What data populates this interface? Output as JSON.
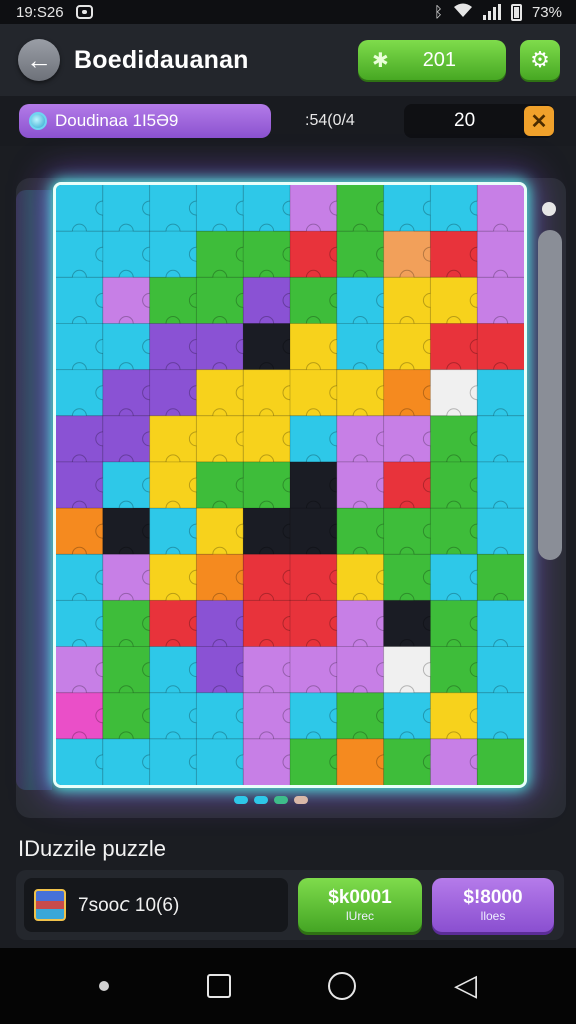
{
  "status_bar": {
    "time": "19:S26",
    "battery_text": "73%",
    "icons": [
      "notification-icon",
      "bluetooth-icon",
      "wifi-icon",
      "signal-icon",
      "battery-icon"
    ]
  },
  "header": {
    "back_icon": "back-arrow-icon",
    "title": "Boedidauanan",
    "coins_icon": "gear-coin-icon",
    "coins_value": "201",
    "settings_icon": "gear-icon"
  },
  "subbar": {
    "level_label": "Doudinaa 1I5Ə9",
    "code": ":54(0/4",
    "moves_value": "20",
    "close_icon": "close-icon"
  },
  "board": {
    "rows": 13,
    "cols": 10,
    "piece_colors": [
      [
        "#2ec8e8",
        "#2ec8e8",
        "#2ec8e8",
        "#2ec8e8",
        "#2ec8e8",
        "#c77fe6",
        "#3ebd3a",
        "#2ec8e8",
        "#2ec8e8",
        "#c77fe6"
      ],
      [
        "#2ec8e8",
        "#2ec8e8",
        "#2ec8e8",
        "#3ebd3a",
        "#3ebd3a",
        "#e8333b",
        "#3ebd3a",
        "#f2a05a",
        "#e8333b",
        "#c77fe6"
      ],
      [
        "#2ec8e8",
        "#c77fe6",
        "#3ebd3a",
        "#3ebd3a",
        "#8a52d4",
        "#3ebd3a",
        "#2ec8e8",
        "#f7d21c",
        "#f7d21c",
        "#c77fe6"
      ],
      [
        "#2ec8e8",
        "#2ec8e8",
        "#8a52d4",
        "#8a52d4",
        "#1a1c24",
        "#f7d21c",
        "#2ec8e8",
        "#f7d21c",
        "#e8333b",
        "#e8333b"
      ],
      [
        "#2ec8e8",
        "#8a52d4",
        "#8a52d4",
        "#f7d21c",
        "#f7d21c",
        "#f7d21c",
        "#f7d21c",
        "#f58a1f",
        "#f0f0f0",
        "#2ec8e8"
      ],
      [
        "#8a52d4",
        "#8a52d4",
        "#f7d21c",
        "#f7d21c",
        "#f7d21c",
        "#2ec8e8",
        "#c77fe6",
        "#c77fe6",
        "#3ebd3a",
        "#2ec8e8"
      ],
      [
        "#8a52d4",
        "#2ec8e8",
        "#f7d21c",
        "#3ebd3a",
        "#3ebd3a",
        "#1a1c24",
        "#c77fe6",
        "#e8333b",
        "#3ebd3a",
        "#2ec8e8"
      ],
      [
        "#f58a1f",
        "#1a1c24",
        "#2ec8e8",
        "#f7d21c",
        "#1a1c24",
        "#1a1c24",
        "#3ebd3a",
        "#3ebd3a",
        "#3ebd3a",
        "#2ec8e8"
      ],
      [
        "#2ec8e8",
        "#c77fe6",
        "#f7d21c",
        "#f58a1f",
        "#e8333b",
        "#e8333b",
        "#f7d21c",
        "#3ebd3a",
        "#2ec8e8",
        "#3ebd3a"
      ],
      [
        "#2ec8e8",
        "#3ebd3a",
        "#e8333b",
        "#8a52d4",
        "#e8333b",
        "#e8333b",
        "#c77fe6",
        "#1a1c24",
        "#3ebd3a",
        "#2ec8e8"
      ],
      [
        "#c77fe6",
        "#3ebd3a",
        "#2ec8e8",
        "#8a52d4",
        "#c77fe6",
        "#c77fe6",
        "#c77fe6",
        "#f0f0f0",
        "#3ebd3a",
        "#2ec8e8"
      ],
      [
        "#ea4fc8",
        "#3ebd3a",
        "#2ec8e8",
        "#2ec8e8",
        "#c77fe6",
        "#2ec8e8",
        "#3ebd3a",
        "#2ec8e8",
        "#f7d21c",
        "#2ec8e8"
      ],
      [
        "#2ec8e8",
        "#2ec8e8",
        "#2ec8e8",
        "#2ec8e8",
        "#c77fe6",
        "#3ebd3a",
        "#f58a1f",
        "#3ebd3a",
        "#c77fe6",
        "#3ebd3a"
      ]
    ]
  },
  "page_dots": [
    "#2ec8e8",
    "#2ec8e8",
    "#3ebd8a",
    "#d9b8a8"
  ],
  "section_title": "IDuzzile puzzle",
  "bottom": {
    "chest_icon": "chest-icon",
    "info_text": "7soo𝘤 10(6)",
    "buy_green_price": "$k0001",
    "buy_green_sub": "lUrec",
    "buy_purple_price": "$!8000",
    "buy_purple_sub": "lloes"
  },
  "nav_bar": {
    "icons": [
      "nav-dot-icon",
      "recent-apps-icon",
      "home-icon",
      "back-triangle-icon"
    ]
  }
}
